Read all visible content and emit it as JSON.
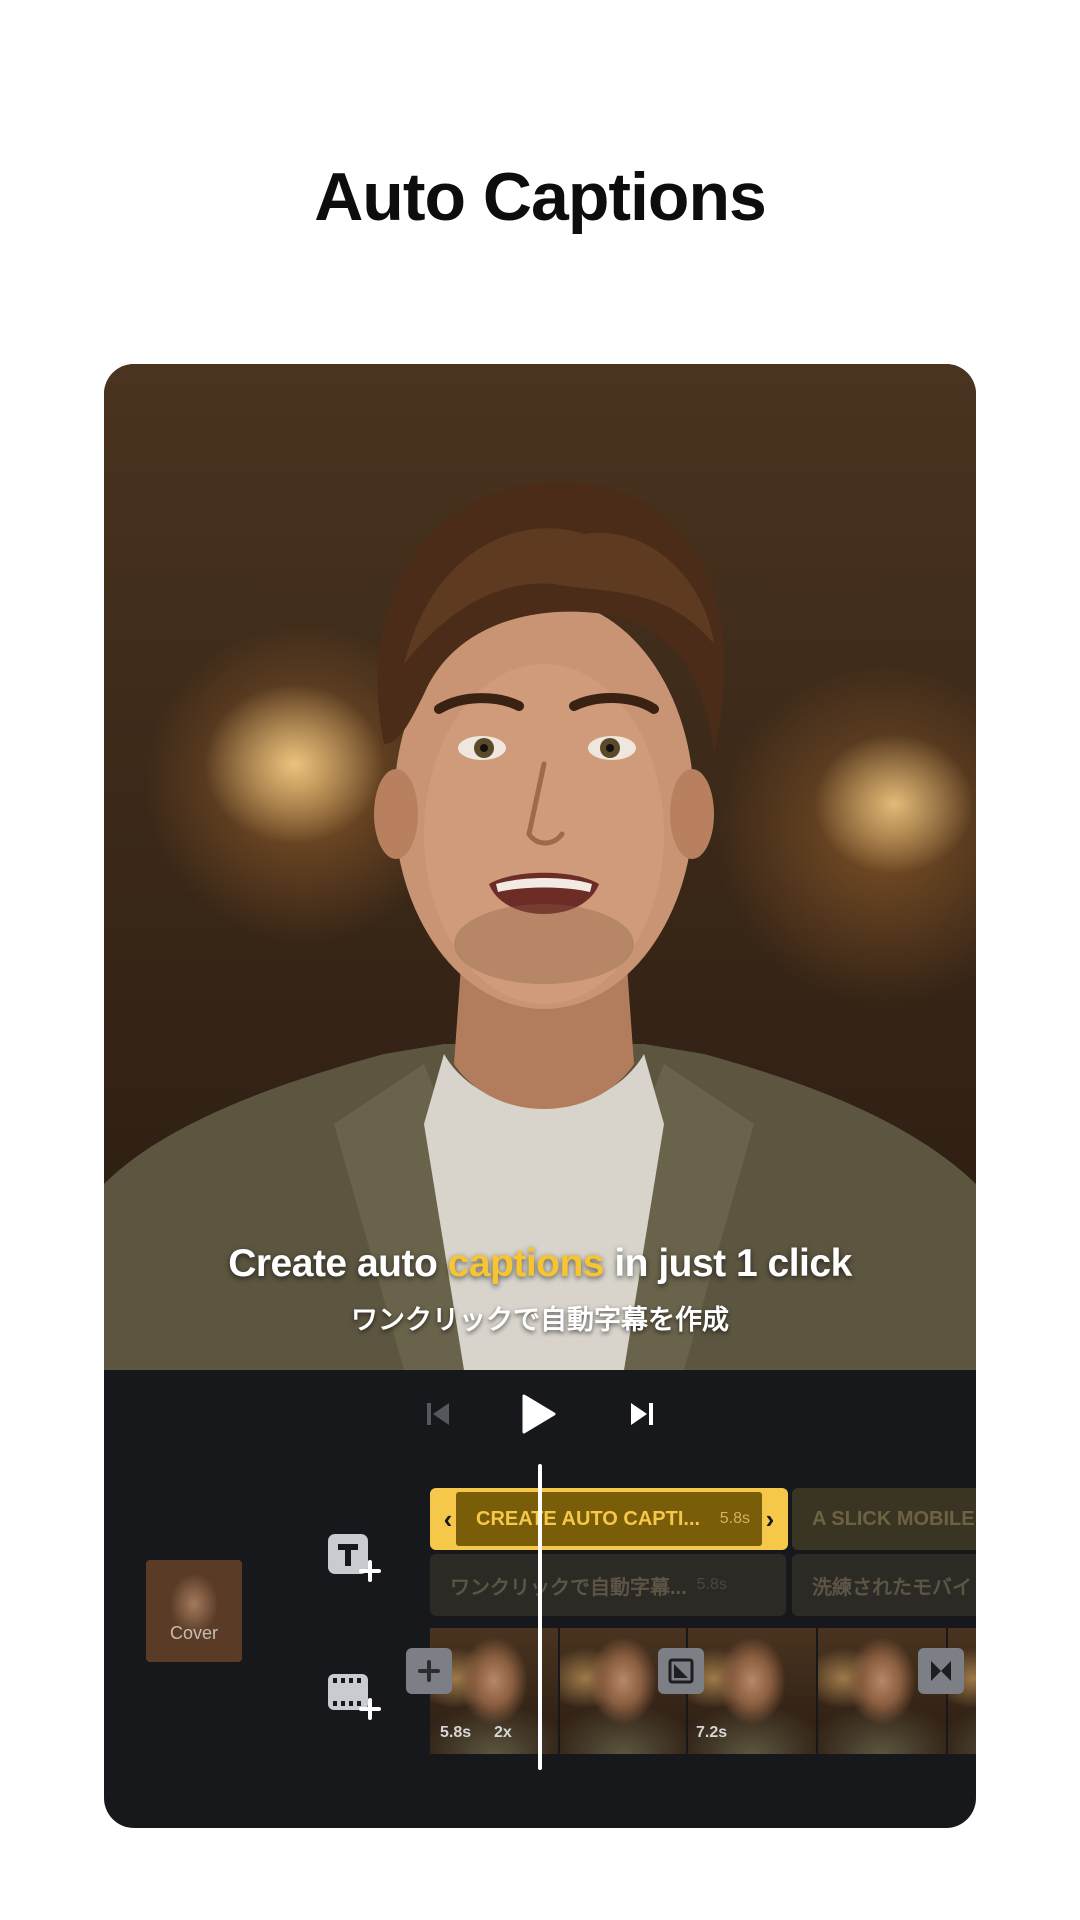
{
  "headline": "Auto Captions",
  "preview": {
    "caption_en_before": "Create auto ",
    "caption_en_highlight": "captions",
    "caption_en_after": " in just 1 click",
    "caption_jp": "ワンクリックで自動字幕を作成"
  },
  "timeline": {
    "cover_label": "Cover",
    "text_track": [
      {
        "label": "CREATE AUTO CAPTI...",
        "duration": "5.8s",
        "selected": true
      },
      {
        "label": "A SLICK MOBILE V",
        "duration": ""
      }
    ],
    "translation_track": [
      {
        "label": "ワンクリックで自動字幕...",
        "duration": "5.8s"
      },
      {
        "label": "洗練されたモバイ",
        "duration": ""
      }
    ],
    "video_track": {
      "clip1_duration": "5.8s",
      "clip1_speed": "2x",
      "clip2_duration": "7.2s"
    }
  },
  "colors": {
    "accent": "#f6c84a",
    "editor_bg": "#17181b"
  }
}
